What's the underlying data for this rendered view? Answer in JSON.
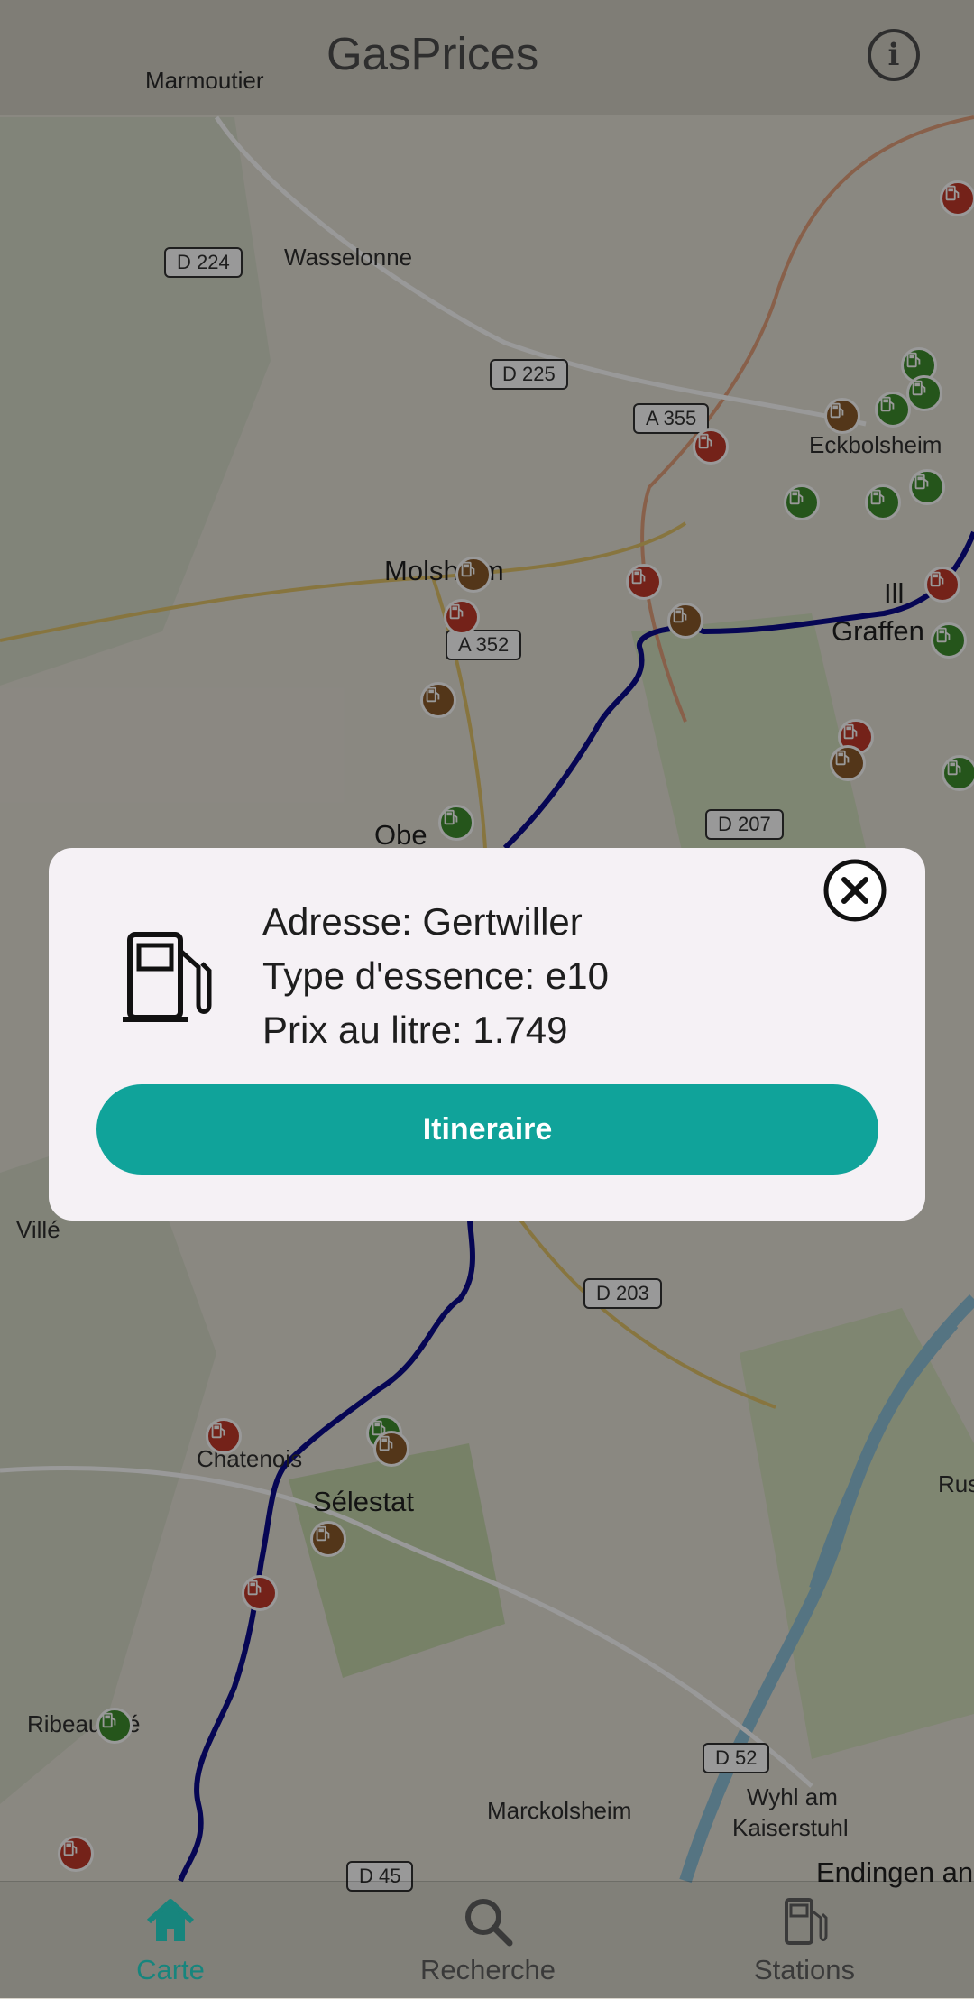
{
  "app": {
    "title": "GasPrices"
  },
  "map": {
    "places": [
      "Marmoutier",
      "Wasselonne",
      "Molsheim",
      "Eckbolsheim",
      "Ill",
      "Graffen",
      "Obe",
      "Villé",
      "Chatenois",
      "Sélestat",
      "Ribeau",
      "é",
      "Marckolsheim",
      "Wyhl am",
      "Kaiserstuhl",
      "Endingen an",
      "Rus"
    ],
    "roads": [
      "D 224",
      "D 225",
      "A 355",
      "A 352",
      "D 207",
      "D 203",
      "D 52",
      "D 45"
    ]
  },
  "popup": {
    "address": "Adresse: Gertwiller",
    "fuel_type": "Type d'essence: e10",
    "price": "Prix au litre: 1.749",
    "button_label": "Itineraire",
    "close_icon": "close-circle-icon",
    "pump_icon": "gas-pump-icon"
  },
  "nav": {
    "items": [
      {
        "label": "Carte",
        "icon": "home-icon",
        "active": true
      },
      {
        "label": "Recherche",
        "icon": "search-icon",
        "active": false
      },
      {
        "label": "Stations",
        "icon": "gas-pump-icon",
        "active": false
      }
    ]
  },
  "colors": {
    "accent": "#10a39a",
    "route": "#0a0a8c",
    "pin_red": "#c23a2a",
    "pin_green": "#3e8e2e",
    "pin_brown": "#8a5a2a"
  }
}
